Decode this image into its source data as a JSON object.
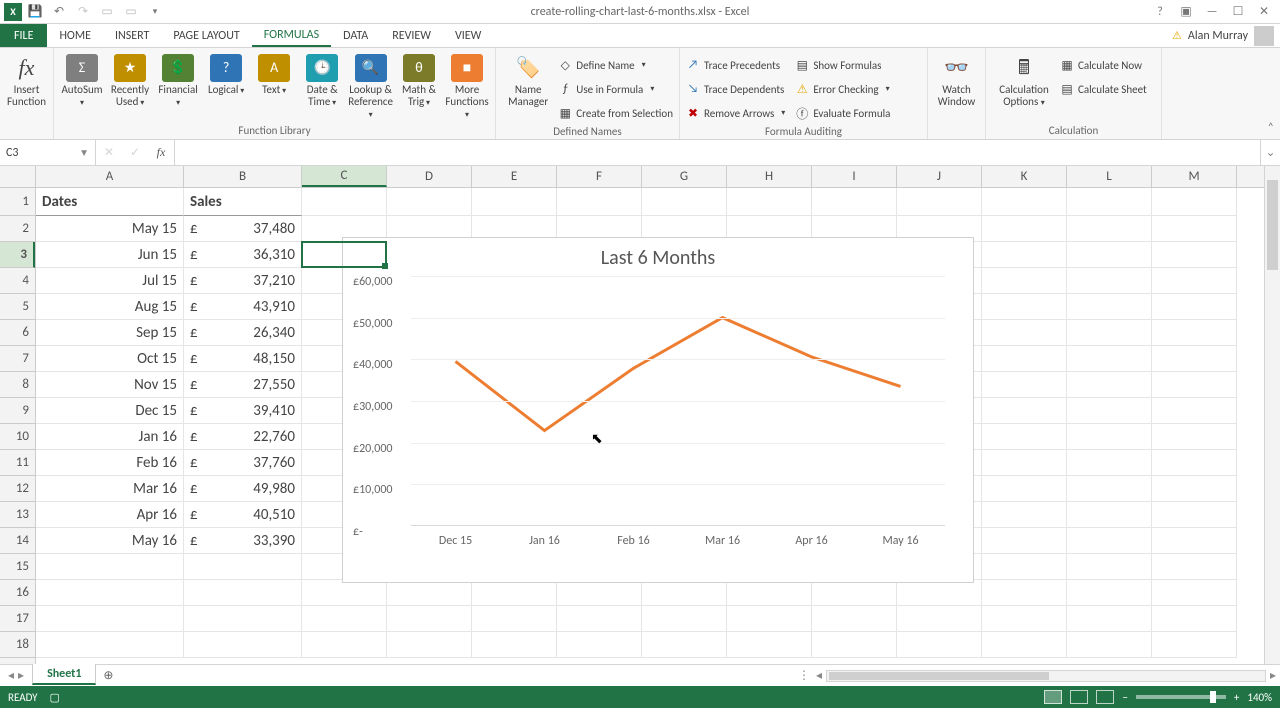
{
  "title": "create-rolling-chart-last-6-months.xlsx - Excel",
  "user": "Alan Murray",
  "tabs": {
    "file": "FILE",
    "home": "HOME",
    "insert": "INSERT",
    "page_layout": "PAGE LAYOUT",
    "formulas": "FORMULAS",
    "data": "DATA",
    "review": "REVIEW",
    "view": "VIEW",
    "active": "formulas"
  },
  "ribbon": {
    "insert_function": "Insert Function",
    "function_library": {
      "label": "Function Library",
      "autosum": "AutoSum",
      "recently": "Recently Used",
      "financial": "Financial",
      "logical": "Logical",
      "text": "Text",
      "date_time": "Date & Time",
      "lookup": "Lookup & Reference",
      "math": "Math & Trig",
      "more": "More Functions"
    },
    "defined_names": {
      "label": "Defined Names",
      "name_manager": "Name Manager",
      "define": "Define Name",
      "use": "Use in Formula",
      "create": "Create from Selection"
    },
    "auditing": {
      "label": "Formula Auditing",
      "trace_p": "Trace Precedents",
      "trace_d": "Trace Dependents",
      "remove": "Remove Arrows",
      "show": "Show Formulas",
      "error": "Error Checking",
      "eval": "Evaluate Formula"
    },
    "watch": "Watch Window",
    "calculation": {
      "label": "Calculation",
      "options": "Calculation Options",
      "now": "Calculate Now",
      "sheet": "Calculate Sheet"
    }
  },
  "namebox": "C3",
  "formula": "",
  "columns": [
    "A",
    "B",
    "C",
    "D",
    "E",
    "F",
    "G",
    "H",
    "I",
    "J",
    "K",
    "L",
    "M"
  ],
  "col_widths": {
    "A": 148,
    "B": 118,
    "default": 85
  },
  "row_heights": {
    "first": 28,
    "default": 26
  },
  "headers": {
    "A": "Dates",
    "B": "Sales"
  },
  "rows": [
    {
      "date": "May 15",
      "sym": "£",
      "val": "37,480"
    },
    {
      "date": "Jun 15",
      "sym": "£",
      "val": "36,310"
    },
    {
      "date": "Jul 15",
      "sym": "£",
      "val": "37,210"
    },
    {
      "date": "Aug 15",
      "sym": "£",
      "val": "43,910"
    },
    {
      "date": "Sep 15",
      "sym": "£",
      "val": "26,340"
    },
    {
      "date": "Oct 15",
      "sym": "£",
      "val": "48,150"
    },
    {
      "date": "Nov 15",
      "sym": "£",
      "val": "27,550"
    },
    {
      "date": "Dec 15",
      "sym": "£",
      "val": "39,410"
    },
    {
      "date": "Jan 16",
      "sym": "£",
      "val": "22,760"
    },
    {
      "date": "Feb 16",
      "sym": "£",
      "val": "37,760"
    },
    {
      "date": "Mar 16",
      "sym": "£",
      "val": "49,980"
    },
    {
      "date": "Apr 16",
      "sym": "£",
      "val": "40,510"
    },
    {
      "date": "May 16",
      "sym": "£",
      "val": "33,390"
    }
  ],
  "selected_cell": {
    "col": "C",
    "row": 3
  },
  "chart_data": {
    "type": "line",
    "title": "Last 6 Months",
    "ylabel": "",
    "ylim": [
      0,
      60000
    ],
    "yticks": [
      "£-",
      "£10,000",
      "£20,000",
      "£30,000",
      "£40,000",
      "£50,000",
      "£60,000"
    ],
    "categories": [
      "Dec 15",
      "Jan 16",
      "Feb 16",
      "Mar 16",
      "Apr 16",
      "May 16"
    ],
    "values": [
      39410,
      22760,
      37760,
      49980,
      40510,
      33390
    ],
    "color": "#ed7d31"
  },
  "sheet_tabs": {
    "active": "Sheet1"
  },
  "status": {
    "ready": "READY",
    "zoom": "140%"
  }
}
